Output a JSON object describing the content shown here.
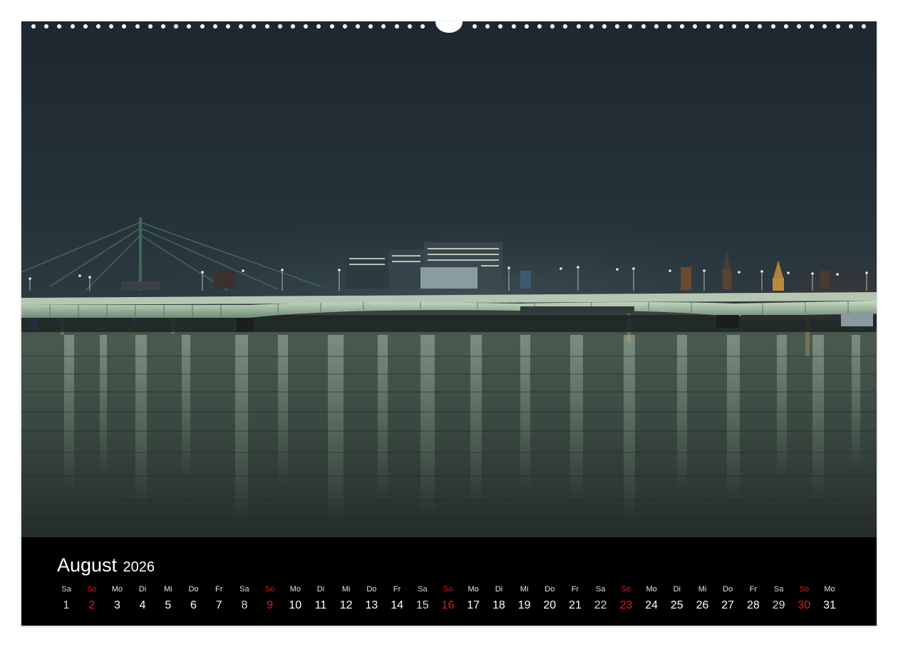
{
  "calendar": {
    "month": "August",
    "year": "2026",
    "days": [
      {
        "wd": "Sa",
        "n": "1",
        "type": "sat"
      },
      {
        "wd": "So",
        "n": "2",
        "type": "sun"
      },
      {
        "wd": "Mo",
        "n": "3",
        "type": "wk"
      },
      {
        "wd": "Di",
        "n": "4",
        "type": "wk"
      },
      {
        "wd": "Mi",
        "n": "5",
        "type": "wk"
      },
      {
        "wd": "Do",
        "n": "6",
        "type": "wk"
      },
      {
        "wd": "Fr",
        "n": "7",
        "type": "wk"
      },
      {
        "wd": "Sa",
        "n": "8",
        "type": "sat"
      },
      {
        "wd": "So",
        "n": "9",
        "type": "sun"
      },
      {
        "wd": "Mo",
        "n": "10",
        "type": "wk"
      },
      {
        "wd": "Di",
        "n": "11",
        "type": "wk"
      },
      {
        "wd": "Mi",
        "n": "12",
        "type": "wk"
      },
      {
        "wd": "Do",
        "n": "13",
        "type": "wk"
      },
      {
        "wd": "Fr",
        "n": "14",
        "type": "wk"
      },
      {
        "wd": "Sa",
        "n": "15",
        "type": "sat"
      },
      {
        "wd": "So",
        "n": "16",
        "type": "sun"
      },
      {
        "wd": "Mo",
        "n": "17",
        "type": "wk"
      },
      {
        "wd": "Di",
        "n": "18",
        "type": "wk"
      },
      {
        "wd": "Mi",
        "n": "19",
        "type": "wk"
      },
      {
        "wd": "Do",
        "n": "20",
        "type": "wk"
      },
      {
        "wd": "Fr",
        "n": "21",
        "type": "wk"
      },
      {
        "wd": "Sa",
        "n": "22",
        "type": "sat"
      },
      {
        "wd": "So",
        "n": "23",
        "type": "sun"
      },
      {
        "wd": "Mo",
        "n": "24",
        "type": "wk"
      },
      {
        "wd": "Di",
        "n": "25",
        "type": "wk"
      },
      {
        "wd": "Mi",
        "n": "26",
        "type": "wk"
      },
      {
        "wd": "Do",
        "n": "27",
        "type": "wk"
      },
      {
        "wd": "Fr",
        "n": "28",
        "type": "wk"
      },
      {
        "wd": "Sa",
        "n": "29",
        "type": "sat"
      },
      {
        "wd": "So",
        "n": "30",
        "type": "sun"
      },
      {
        "wd": "Mo",
        "n": "31",
        "type": "wk"
      }
    ]
  },
  "colors": {
    "sunday": "#e31b23",
    "calendar_bg": "#000000",
    "sky_top": "#1f2a33",
    "water": "#3d4a42"
  },
  "photo": {
    "scene": "night-river-bridge-skyline"
  }
}
